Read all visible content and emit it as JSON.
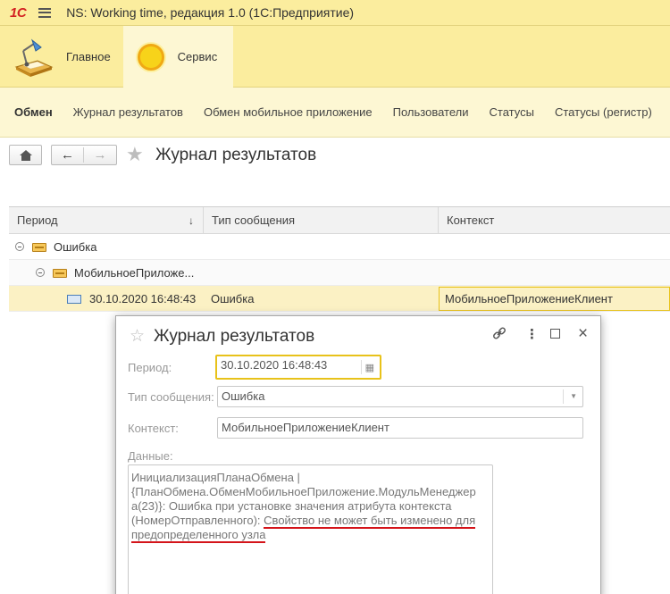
{
  "titlebar": {
    "logo": "1С",
    "title": "NS: Working time, редакция 1.0  (1С:Предприятие)"
  },
  "sections": [
    {
      "label": "Главное",
      "icon": "desk-lamp-icon"
    },
    {
      "label": "Сервис",
      "icon": "sun-icon",
      "active": true
    }
  ],
  "navbar": {
    "items": [
      "Обмен",
      "Журнал результатов",
      "Обмен мобильное приложение",
      "Пользователи",
      "Статусы",
      "Статусы (регистр)"
    ]
  },
  "form": {
    "title": "Журнал результатов"
  },
  "table": {
    "columns": [
      "Период",
      "Тип сообщения",
      "Контекст"
    ],
    "sort_indicator": "↓",
    "group1": "Ошибка",
    "group2": "МобильноеПриложе...",
    "row": {
      "period": "30.10.2020 16:48:43",
      "type": "Ошибка",
      "context": "МобильноеПриложениеКлиент"
    }
  },
  "dialog": {
    "title": "Журнал результатов",
    "period_label": "Период:",
    "period_value": "30.10.2020 16:48:43",
    "type_label": "Тип сообщения:",
    "type_value": "Ошибка",
    "context_label": "Контекст:",
    "context_value": "МобильноеПриложениеКлиент",
    "data_label": "Данные:",
    "data_line1": "ИнициализацияПланаОбмена |",
    "data_line2": "{ПланОбмена.ОбменМобильноеПриложение.МодульМенеджер",
    "data_line3": "а(23)}: Ошибка при установке значения атрибута контекста",
    "data_line4a": "(НомерОтправленного): ",
    "data_line4b": "Свойство не может быть изменено для",
    "data_line5": "предопределенного узла"
  },
  "colors": {
    "panel_yellow": "#fbed9e",
    "light_yellow": "#fdf7d3",
    "focus_border": "#e8c21a",
    "underline_red": "#d4141a"
  }
}
